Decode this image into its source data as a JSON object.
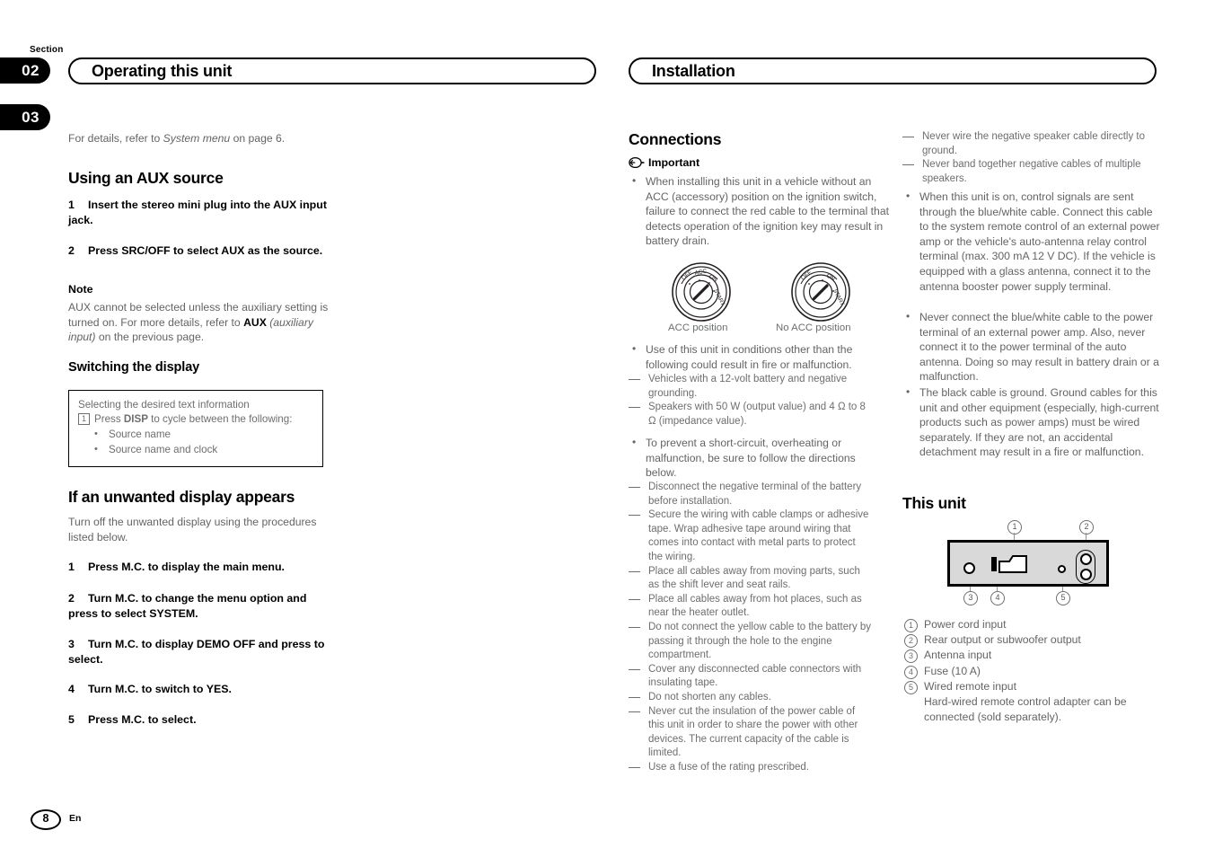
{
  "page": {
    "section_word": "Section",
    "section_tabs": [
      "02",
      "03"
    ],
    "page_number": "8",
    "language": "En"
  },
  "headers": {
    "left": "Operating this unit",
    "right": "Installation"
  },
  "left_column": {
    "intro_prefix": "For details, refer to ",
    "intro_italic": "System menu",
    "intro_suffix": " on page 6.",
    "heading_aux": "Using an AUX source",
    "steps_aux": [
      {
        "num": "1",
        "text": "Insert the stereo mini plug into the AUX input jack."
      },
      {
        "num": "2",
        "text": "Press SRC/OFF to select AUX as the source."
      }
    ],
    "note_label": "Note",
    "note_part1": "AUX cannot be selected unless the auxiliary setting is turned on. For more details, refer to ",
    "note_bold": "AUX",
    "note_italic": " (auxiliary input)",
    "note_part2": " on the previous page.",
    "heading_switching": "Switching the display",
    "tipbox": {
      "title": "Selecting the desired text information",
      "step_num": "1",
      "step_pre": "Press ",
      "step_bold": "DISP",
      "step_post": " to cycle between the following:",
      "bullets": [
        "Source name",
        "Source name and clock"
      ]
    },
    "heading_unwanted": "If an unwanted display appears",
    "unwanted_intro": "Turn off the unwanted display using the procedures listed below.",
    "steps_unwanted": [
      {
        "num": "1",
        "text": "Press M.C. to display the main menu."
      },
      {
        "num": "2",
        "text": "Turn M.C. to change the menu option and press to select SYSTEM."
      },
      {
        "num": "3",
        "text": "Turn M.C. to display DEMO OFF and press to select."
      },
      {
        "num": "4",
        "text": "Turn M.C. to switch to YES."
      },
      {
        "num": "5",
        "text": "Press M.C. to select."
      }
    ]
  },
  "middle_column": {
    "heading_connections": "Connections",
    "important_label": "Important",
    "bullet_1": "When installing this unit in a vehicle without an ACC (accessory) position on the ignition switch, failure to connect the red cable to the terminal that detects operation of the ignition key may result in battery drain.",
    "acc_diagram": {
      "caption_left": "ACC position",
      "caption_right": "No ACC position",
      "labels": [
        "OFF",
        "ACC",
        "ON",
        "START"
      ]
    },
    "bullet_2": "Use of this unit in conditions other than the following could result in fire or malfunction.",
    "bullet_2_sub": [
      "Vehicles with a 12-volt battery and negative grounding.",
      "Speakers with 50 W (output value) and 4 Ω to 8 Ω (impedance value)."
    ],
    "bullet_3": "To prevent a short-circuit, overheating or malfunction, be sure to follow the directions below.",
    "bullet_3_sub": [
      "Disconnect the negative terminal of the battery before installation.",
      "Secure the wiring with cable clamps or adhesive tape. Wrap adhesive tape around wiring that comes into contact with metal parts to protect the wiring.",
      "Place all cables away from moving parts, such as the shift lever and seat rails.",
      "Place all cables away from hot places, such as near the heater outlet.",
      "Do not connect the yellow cable to the battery by passing it through the hole to the engine compartment.",
      "Cover any disconnected cable connectors with insulating tape.",
      "Do not shorten any cables.",
      "Never cut the insulation of the power cable of this unit in order to share the power with other devices. The current capacity of the cable is limited.",
      "Use a fuse of the rating prescribed."
    ]
  },
  "right_column": {
    "top_dashes": [
      "Never wire the negative speaker cable directly to ground.",
      "Never band together negative cables of multiple speakers."
    ],
    "bullets": [
      "When this unit is on, control signals are sent through the blue/white cable. Connect this cable to the system remote control of an external power amp or the vehicle's auto-antenna relay control terminal (max. 300 mA 12 V DC). If the vehicle is equipped with a glass antenna, connect it to the antenna booster power supply terminal.",
      "Never connect the blue/white cable to the power terminal of an external power amp. Also, never connect it to the power terminal of the auto antenna. Doing so may result in battery drain or a malfunction.",
      "The black cable is ground. Ground cables for this unit and other equipment (especially, high-current products such as power amps) must be wired separately. If they are not, an accidental detachment may result in a fire or malfunction."
    ],
    "heading_this_unit": "This unit",
    "diagram_callouts": [
      "1",
      "2",
      "3",
      "4",
      "5"
    ],
    "legend": [
      {
        "num": "1",
        "text": "Power cord input"
      },
      {
        "num": "2",
        "text": "Rear output or subwoofer output"
      },
      {
        "num": "3",
        "text": "Antenna input"
      },
      {
        "num": "4",
        "text": "Fuse (10 A)"
      },
      {
        "num": "5",
        "text": "Wired remote input"
      }
    ],
    "legend_continued": "Hard-wired remote control adapter can be connected (sold separately)."
  },
  "colors": {
    "ink": "#000000",
    "body_text": "#636466",
    "panel_fill": "#d9d9d9"
  }
}
